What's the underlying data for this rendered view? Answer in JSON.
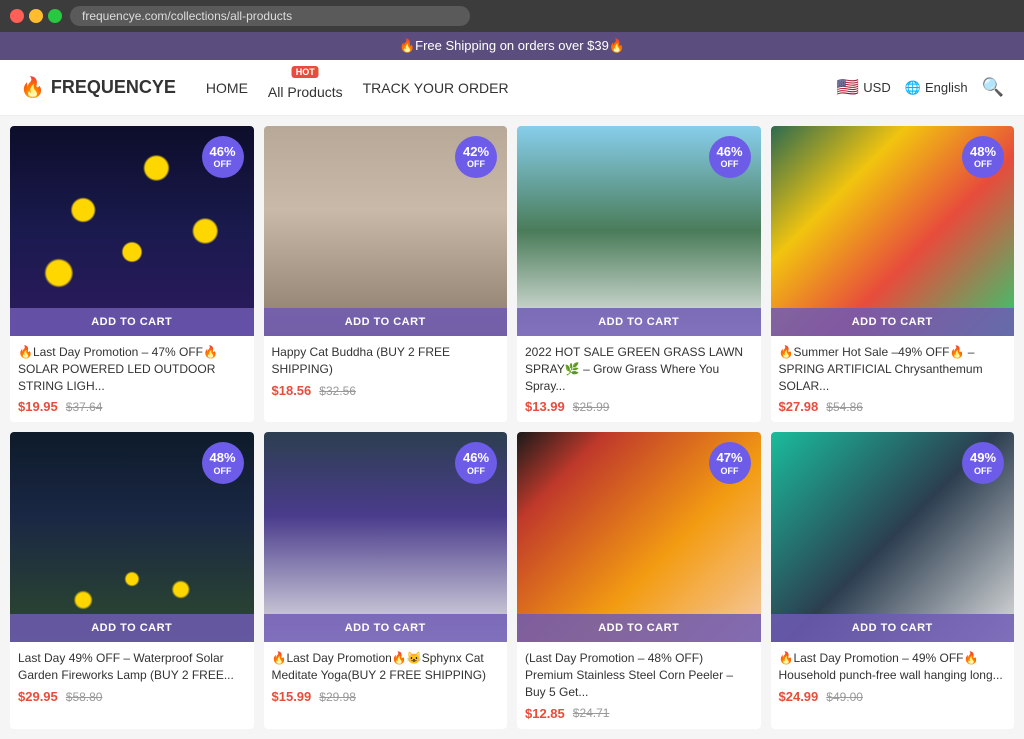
{
  "browser": {
    "url": "frequencye.com/collections/all-products"
  },
  "promo_bar": {
    "text": "🔥Free Shipping on orders over $39🔥"
  },
  "header": {
    "logo": "FREQUENCYE",
    "logo_icon": "🔥",
    "nav": [
      {
        "id": "home",
        "label": "HOME",
        "hot": false
      },
      {
        "id": "all-products",
        "label": "All Products",
        "hot": true
      },
      {
        "id": "track-order",
        "label": "TRACK YOUR ORDER",
        "hot": false
      }
    ],
    "currency": "USD",
    "language": "English",
    "hot_label": "HOT"
  },
  "products": [
    {
      "id": 1,
      "title": "🔥Last Day Promotion – 47% OFF🔥SOLAR POWERED LED OUTDOOR STRING LIGH...",
      "discount": "46",
      "price": "$19.95",
      "original_price": "$37.64",
      "add_to_cart": "ADD TO CART",
      "img_class": "img-solar-lights"
    },
    {
      "id": 2,
      "title": "Happy Cat Buddha (BUY 2 FREE SHIPPING)",
      "discount": "42",
      "price": "$18.56",
      "original_price": "$32.56",
      "add_to_cart": "ADD TO CART",
      "img_class": "img-cat-buddha"
    },
    {
      "id": 3,
      "title": "2022 HOT SALE GREEN GRASS LAWN SPRAY🌿 – Grow Grass Where You Spray...",
      "discount": "46",
      "price": "$13.99",
      "original_price": "$25.99",
      "add_to_cart": "ADD TO CART",
      "img_class": "img-grass-spray"
    },
    {
      "id": 4,
      "title": "🔥Summer Hot Sale –49% OFF🔥 – SPRING ARTIFICIAL Chrysanthemum SOLAR...",
      "discount": "48",
      "price": "$27.98",
      "original_price": "$54.86",
      "add_to_cart": "ADD TO CART",
      "img_class": "img-chrysanthemum"
    },
    {
      "id": 5,
      "title": "Last Day 49% OFF – Waterproof Solar Garden Fireworks Lamp (BUY 2 FREE...",
      "discount": "48",
      "price": "$29.95",
      "original_price": "$58.80",
      "add_to_cart": "ADD TO CART",
      "img_class": "img-fireworks"
    },
    {
      "id": 6,
      "title": "🔥Last Day Promotion🔥😺Sphynx Cat Meditate Yoga(BUY 2 FREE SHIPPING)",
      "discount": "46",
      "price": "$15.99",
      "original_price": "$29.98",
      "add_to_cart": "ADD TO CART",
      "img_class": "img-sphynx"
    },
    {
      "id": 7,
      "title": "(Last Day Promotion – 48% OFF) Premium Stainless Steel Corn Peeler – Buy 5 Get...",
      "discount": "47",
      "price": "$12.85",
      "original_price": "$24.71",
      "add_to_cart": "ADD TO CART",
      "img_class": "img-corn-peeler"
    },
    {
      "id": 8,
      "title": "🔥Last Day Promotion – 49% OFF🔥 Household punch-free wall hanging long...",
      "discount": "49",
      "price": "$24.99",
      "original_price": "$49.00",
      "add_to_cart": "ADD TO CART",
      "img_class": "img-wall-hanging"
    }
  ]
}
